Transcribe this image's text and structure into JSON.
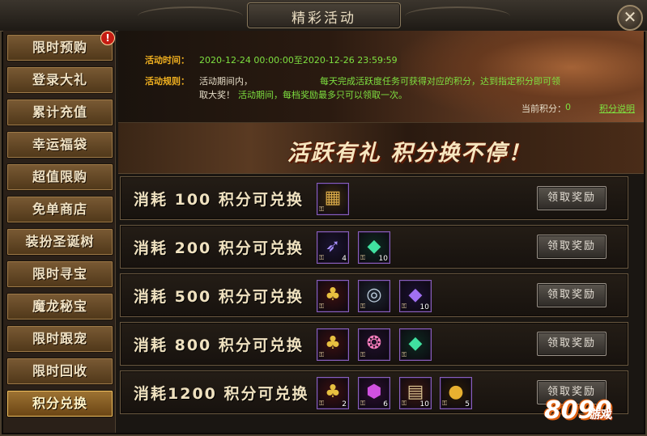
{
  "window": {
    "title": "精彩活动",
    "close_label": "✕"
  },
  "sidebar": {
    "items": [
      {
        "label": "限时预购"
      },
      {
        "label": "登录大礼"
      },
      {
        "label": "累计充值"
      },
      {
        "label": "幸运福袋"
      },
      {
        "label": "超值限购"
      },
      {
        "label": "免单商店"
      },
      {
        "label": "装扮圣诞树"
      },
      {
        "label": "限时寻宝"
      },
      {
        "label": "魔龙秘宝"
      },
      {
        "label": "限时跟宠"
      },
      {
        "label": "限时回收"
      },
      {
        "label": "积分兑换"
      }
    ],
    "active_index": 11,
    "alert_badge": "!"
  },
  "info": {
    "time_label": "活动时间：",
    "time_value": "2020-12-24 00:00:00至2020-12-26 23:59:59",
    "rule_label": "活动规则：",
    "rule_part1": "活动期间内，",
    "rule_part2": "每天完成活跃度任务可获得对应的积分，达到指定积分即可领",
    "rule_part3": "取大奖！",
    "rule_part4": "活动期间，每档奖励最多只可以领取一次。",
    "points_label": "当前积分：",
    "points_value": "0",
    "points_help": "积分说明"
  },
  "banner": {
    "text": "活跃有礼  积分换不停！"
  },
  "tiers": [
    {
      "label": "消耗 100 积分可兑换",
      "claim_label": "领取奖励",
      "items": [
        {
          "icon": "treasure-chest-icon",
          "count": ""
        }
      ]
    },
    {
      "label": "消耗 200 积分可兑换",
      "claim_label": "领取奖励",
      "items": [
        {
          "icon": "feather-icon",
          "count": "4"
        },
        {
          "icon": "green-crystal-icon",
          "count": "10"
        }
      ]
    },
    {
      "label": "消耗 500 积分可兑换",
      "claim_label": "领取奖励",
      "items": [
        {
          "icon": "christmas-bell-icon",
          "count": ""
        },
        {
          "icon": "compass-orb-icon",
          "count": ""
        },
        {
          "icon": "purple-crystal-icon",
          "count": "10"
        }
      ]
    },
    {
      "label": "消耗 800 积分可兑换",
      "claim_label": "领取奖励",
      "items": [
        {
          "icon": "christmas-bell-icon",
          "count": ""
        },
        {
          "icon": "rainbow-gem-icon",
          "count": ""
        },
        {
          "icon": "green-crystal-icon",
          "count": ""
        }
      ]
    },
    {
      "label": "消耗1200 积分可兑换",
      "claim_label": "领取奖励",
      "items": [
        {
          "icon": "christmas-bell-icon",
          "count": "2"
        },
        {
          "icon": "purple-gem-icon",
          "count": "6"
        },
        {
          "icon": "scroll-icon",
          "count": "10"
        },
        {
          "icon": "gold-coin-icon",
          "count": "5"
        }
      ]
    }
  ],
  "watermark": {
    "number": "8090",
    "text": "游戏"
  }
}
